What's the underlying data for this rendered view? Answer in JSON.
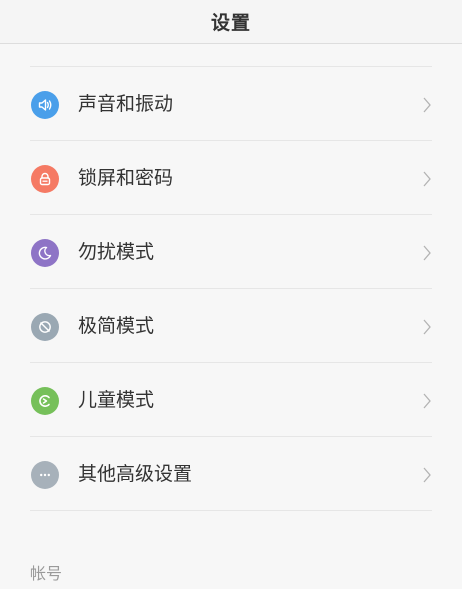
{
  "header": {
    "title": "设置"
  },
  "settings": [
    {
      "label": "声音和振动",
      "icon": "speaker-icon",
      "color": "#4a9fea"
    },
    {
      "label": "锁屏和密码",
      "icon": "lock-icon",
      "color": "#f57a64"
    },
    {
      "label": "勿扰模式",
      "icon": "moon-icon",
      "color": "#8e74c6"
    },
    {
      "label": "极简模式",
      "icon": "minimal-mode-icon",
      "color": "#9aa8b3"
    },
    {
      "label": "儿童模式",
      "icon": "child-mode-icon",
      "color": "#76c05a"
    },
    {
      "label": "其他高级设置",
      "icon": "more-icon",
      "color": "#a7b1ba"
    }
  ],
  "sections": {
    "account": "帐号"
  }
}
